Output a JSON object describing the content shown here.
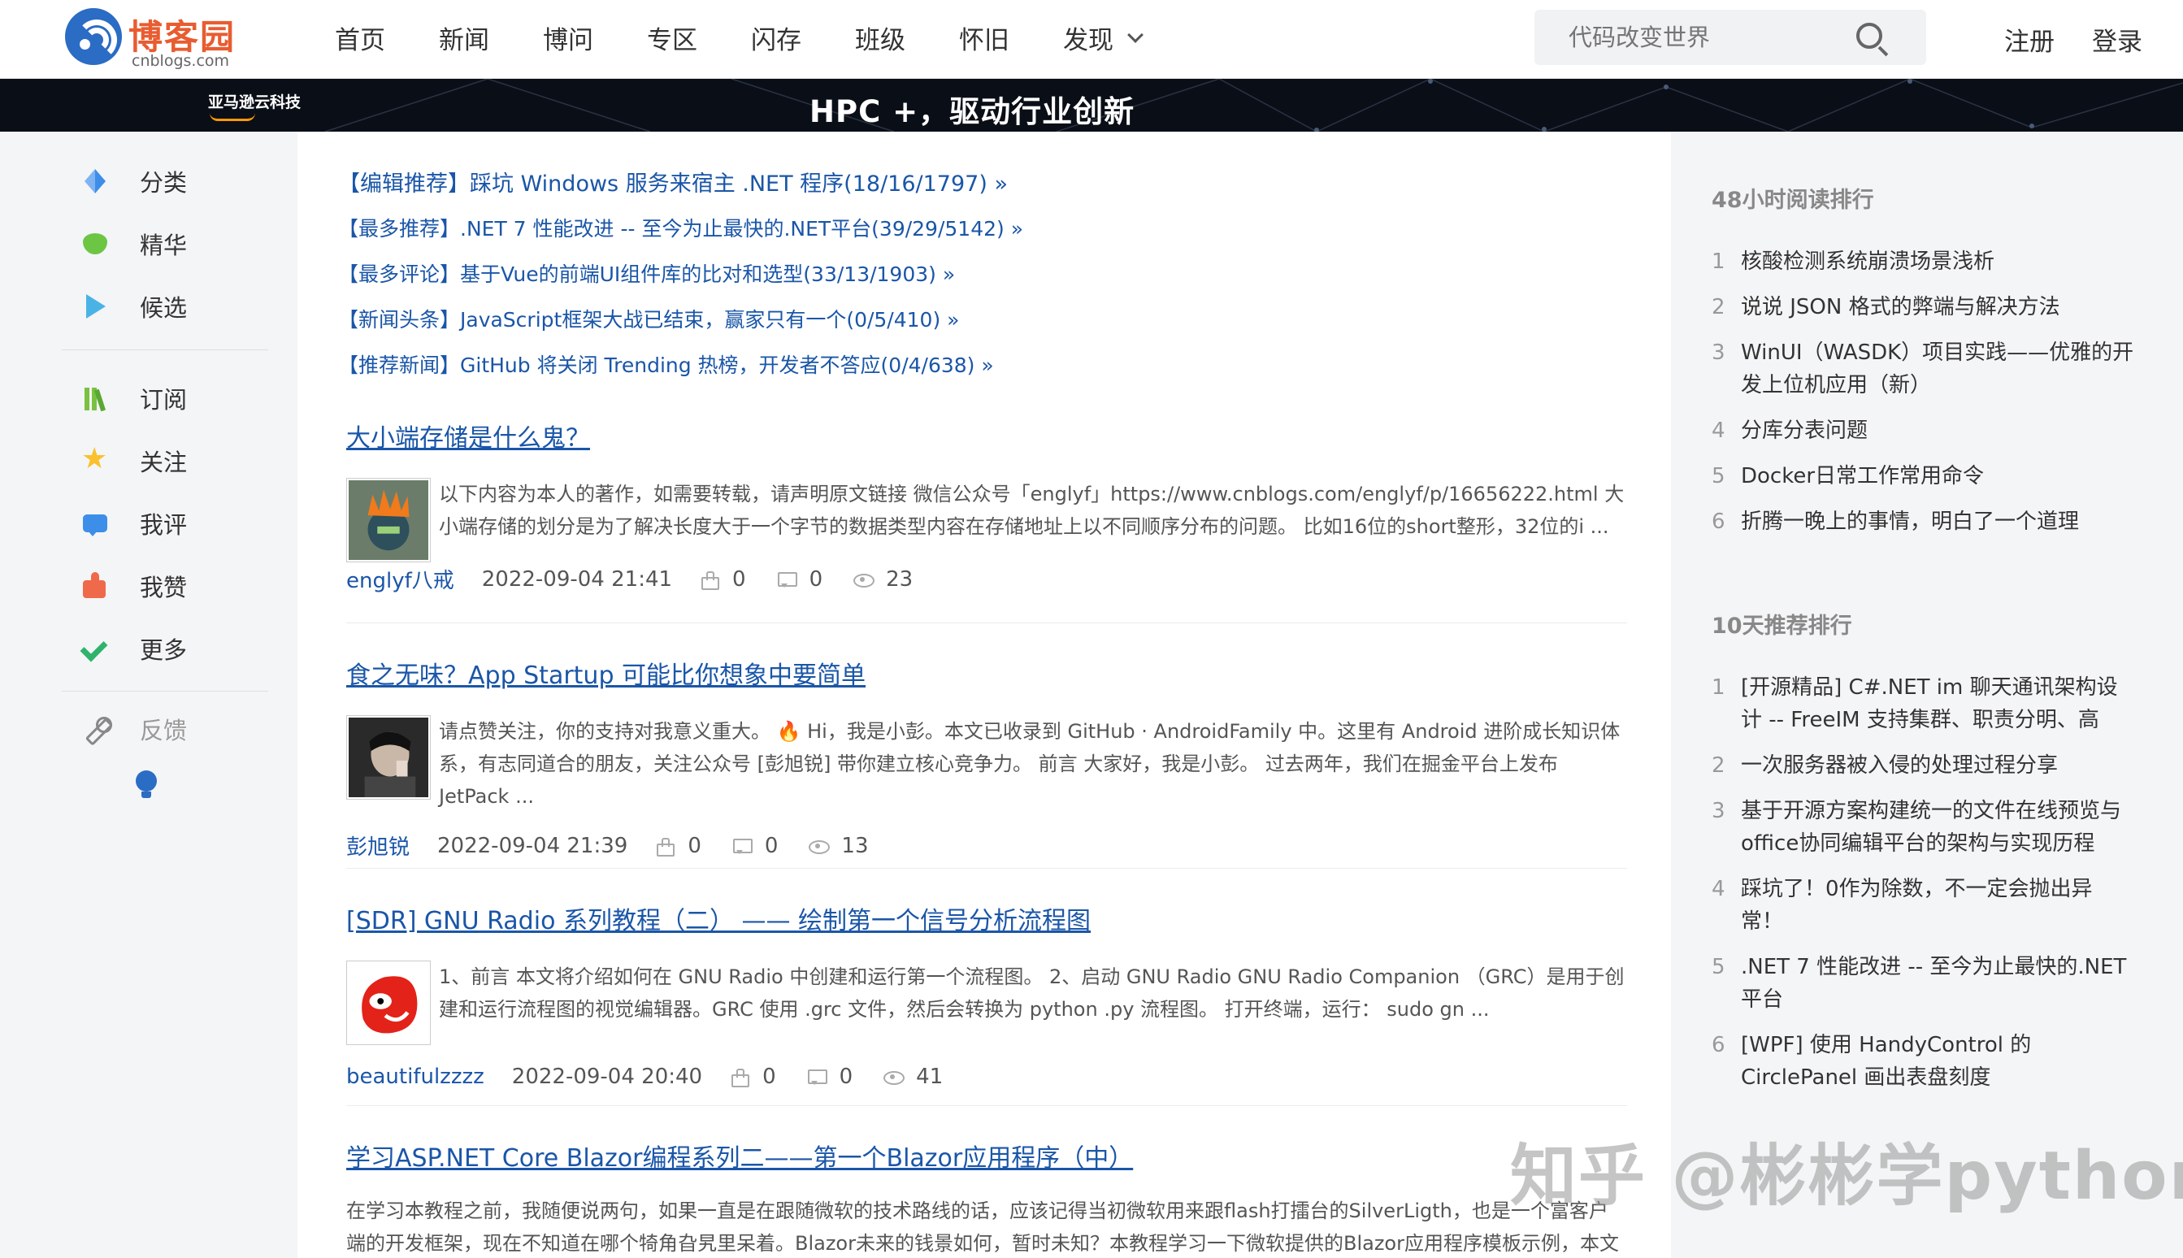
{
  "header": {
    "logo_text": "博客园",
    "logo_sub": "cnblogs.com",
    "nav": [
      "首页",
      "新闻",
      "博问",
      "专区",
      "闪存",
      "班级",
      "怀旧",
      "发现"
    ],
    "search_placeholder": "代码改变世界",
    "register": "注册",
    "login": "登录"
  },
  "banner": {
    "brand": "亚马逊云科技",
    "title": "HPC +，驱动行业创新"
  },
  "sidebar": {
    "items": [
      {
        "label": "分类",
        "icon": "split-icon"
      },
      {
        "label": "精华",
        "icon": "gem-icon"
      },
      {
        "label": "候选",
        "icon": "play-icon"
      },
      {
        "label": "订阅",
        "icon": "books-icon"
      },
      {
        "label": "关注",
        "icon": "star-icon"
      },
      {
        "label": "我评",
        "icon": "comment-icon"
      },
      {
        "label": "我赞",
        "icon": "thumb-icon"
      },
      {
        "label": "更多",
        "icon": "check-icon"
      },
      {
        "label": "反馈",
        "icon": "wrench-icon"
      }
    ]
  },
  "recommendations": [
    "【编辑推荐】踩坑 Windows 服务来宿主 .NET 程序(18/16/1797) »",
    "【最多推荐】.NET 7 性能改进 -- 至今为止最快的.NET平台(39/29/5142) »",
    "【最多评论】基于Vue的前端UI组件库的比对和选型(33/13/1903) »",
    "【新闻头条】JavaScript框架大战已结束，赢家只有一个(0/5/410) »",
    "【推荐新闻】GitHub 将关闭 Trending 热榜，开发者不答应(0/4/638) »"
  ],
  "posts": [
    {
      "title": "大小端存储是什么鬼？",
      "summary": "以下内容为本人的著作，如需要转载，请声明原文链接 微信公众号「englyf」https://www.cnblogs.com/englyf/p/16656222.html 大小端存储的划分是为了解决长度大于一个字节的数据类型内容在存储地址上以不同顺序分布的问题。 比如16位的short整形，32位的i ...",
      "author": "englyf八戒",
      "date": "2022-09-04 21:41",
      "likes": "0",
      "comments": "0",
      "views": "23"
    },
    {
      "title": "食之无味？App Startup 可能比你想象中要简单",
      "summary": "请点赞关注，你的支持对我意义重大。 🔥 Hi，我是小彭。本文已收录到 GitHub · AndroidFamily 中。这里有 Android 进阶成长知识体系，有志同道合的朋友，关注公众号 [彭旭锐] 带你建立核心竞争力。 前言 大家好，我是小彭。 过去两年，我们在掘金平台上发布 JetPack ...",
      "author": "彭旭锐",
      "date": "2022-09-04 21:39",
      "likes": "0",
      "comments": "0",
      "views": "13"
    },
    {
      "title": "[SDR] GNU Radio 系列教程（二） —— 绘制第一个信号分析流程图",
      "summary": "1、前言 本文将介绍如何在 GNU Radio 中创建和运行第一个流程图。 2、启动 GNU Radio GNU Radio Companion （GRC）是用于创建和运行流程图的视觉编辑器。GRC 使用 .grc 文件，然后会转换为 python .py 流程图。 打开终端，运行： sudo gn ...",
      "author": "beautifulzzzz",
      "date": "2022-09-04 20:40",
      "likes": "0",
      "comments": "0",
      "views": "41"
    },
    {
      "title": "学习ASP.NET Core Blazor编程系列二——第一个Blazor应用程序（中）",
      "summary": "在学习本教程之前，我随便说两句，如果一直是在跟随微软的技术路线的话，应该记得当初微软用来跟flash打擂台的SilverLigth，也是一个富客户端的开发框架，现在不知道在哪个犄角旮旯里呆着。Blazor未来的钱景如何，暂时未知？本教程学习一下微软提供的Blazor应用程序模板示例，本文介"
    }
  ],
  "right": {
    "hot48_title": "48小时阅读排行",
    "hot48": [
      {
        "n": "1",
        "text": "核酸检测系统崩溃场景浅析"
      },
      {
        "n": "2",
        "text": "说说 JSON 格式的弊端与解决方法"
      },
      {
        "n": "3",
        "text": "WinUI（WASDK）项目实践——优雅的开发上位机应用（新）"
      },
      {
        "n": "4",
        "text": "分库分表问题"
      },
      {
        "n": "5",
        "text": "Docker日常工作常用命令"
      },
      {
        "n": "6",
        "text": "折腾一晚上的事情，明白了一个道理"
      }
    ],
    "rec10_title": "10天推荐排行",
    "rec10": [
      {
        "n": "1",
        "text": "[开源精品] C#.NET im 聊天通讯架构设计 -- FreeIM 支持集群、职责分明、高"
      },
      {
        "n": "2",
        "text": "一次服务器被入侵的处理过程分享"
      },
      {
        "n": "3",
        "text": "基于开源方案构建统一的文件在线预览与office协同编辑平台的架构与实现历程"
      },
      {
        "n": "4",
        "text": "踩坑了！0作为除数，不一定会抛出异常！"
      },
      {
        "n": "5",
        "text": ".NET 7 性能改进 -- 至今为止最快的.NET平台"
      },
      {
        "n": "6",
        "text": "[WPF] 使用 HandyControl 的 CirclePanel 画出表盘刻度"
      }
    ]
  },
  "watermark": "知乎 @彬彬学python",
  "colors": {
    "link": "#1a56a8",
    "brand": "#e85c30",
    "logo": "#2b6cc4"
  }
}
